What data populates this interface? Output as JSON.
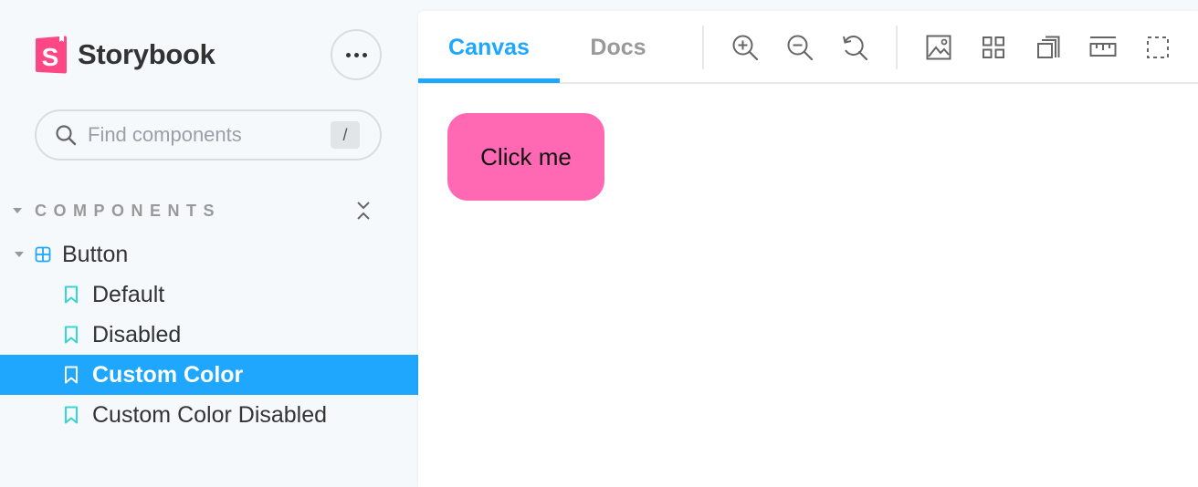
{
  "brand": {
    "name": "Storybook",
    "logo_letter": "S",
    "accent": "#ff4785"
  },
  "search": {
    "placeholder": "Find components",
    "shortcut": "/"
  },
  "sidebar": {
    "section_title": "COMPONENTS",
    "component": {
      "label": "Button",
      "icon": "component-grid-icon"
    },
    "stories": [
      {
        "label": "Default",
        "selected": false
      },
      {
        "label": "Disabled",
        "selected": false
      },
      {
        "label": "Custom Color",
        "selected": true
      },
      {
        "label": "Custom Color Disabled",
        "selected": false
      }
    ]
  },
  "toolbar": {
    "tabs": [
      {
        "label": "Canvas",
        "active": true
      },
      {
        "label": "Docs",
        "active": false
      }
    ],
    "tools": [
      "zoom-in-icon",
      "zoom-out-icon",
      "zoom-reset-icon",
      "background-image-icon",
      "grid-icon",
      "viewport-icon",
      "measure-ruler-icon",
      "outline-icon"
    ]
  },
  "canvas": {
    "button_label": "Click me",
    "button_color": "#ff69b4"
  },
  "colors": {
    "selected": "#1ea7fd",
    "sidebar_bg": "#f6f9fc",
    "story_icon": "#37d5d3",
    "component_icon": "#1ea7fd"
  }
}
